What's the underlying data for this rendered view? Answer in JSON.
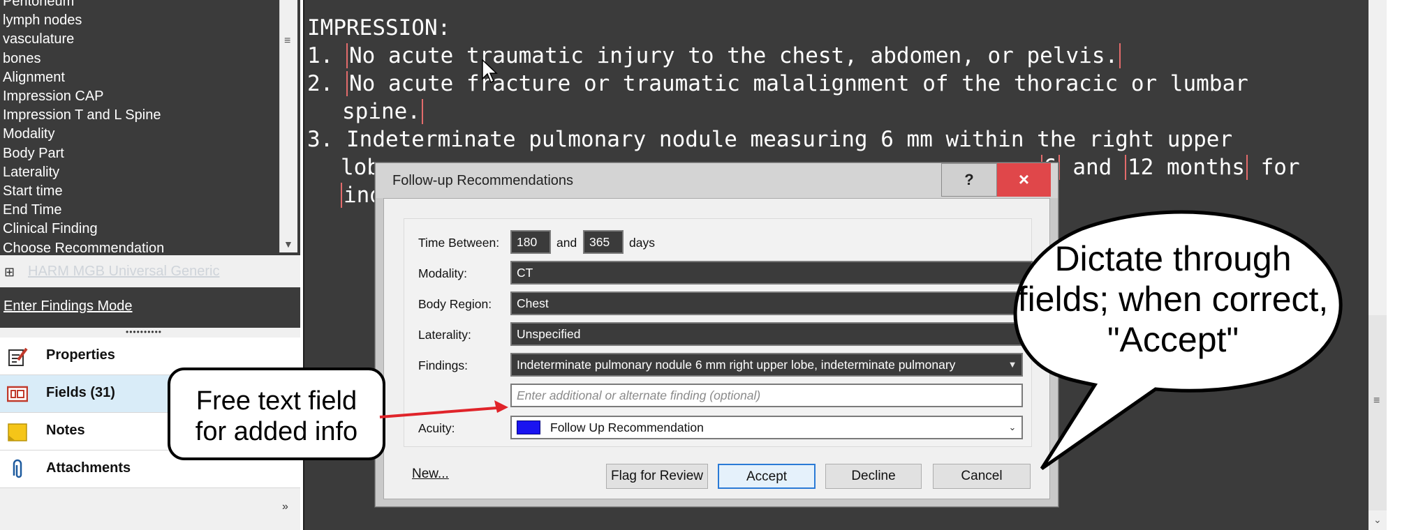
{
  "field_list": {
    "items": [
      "Peritoneum",
      "lymph nodes",
      "vasculature",
      "bones",
      "Alignment",
      "Impression CAP",
      "Impression T and L Spine",
      "Modality",
      "Body Part",
      "Laterality",
      "Start time",
      "End Time",
      "Clinical Finding",
      "Choose Recommendation"
    ]
  },
  "template": {
    "name": "HARM MGB Universal Generic"
  },
  "findings_mode": {
    "label": "Enter Findings Mode"
  },
  "nav": {
    "properties": "Properties",
    "fields": "Fields (31)",
    "notes": "Notes",
    "attachments": "Attachments",
    "more": "»"
  },
  "report": {
    "heading": "IMPRESSION:",
    "l1_num": "1. ",
    "l1_field": "No acute traumatic injury to the chest, abdomen, or pelvis.",
    "l2_num": "2. ",
    "l2_field_a": "No acute fracture or traumatic malalignment of the thoracic or lumbar",
    "l2_field_b": "spine.",
    "l3_a": "3. Indeterminate pulmonary nodule measuring 6 mm within the right upper",
    "l3_b_start": "lob",
    "l3_b_num1": "6",
    "l3_b_and": " and ",
    "l3_b_num2": "12 months",
    "l3_b_for": " for",
    "l3_c": "ind"
  },
  "dialog": {
    "title": "Follow-up Recommendations",
    "help": "?",
    "close": "×",
    "time_between_label": "Time Between:",
    "time_from": "180",
    "and_label": "and",
    "time_to": "365",
    "days_label": "days",
    "modality_label": "Modality:",
    "modality_value": "CT",
    "body_region_label": "Body Region:",
    "body_region_value": "Chest",
    "laterality_label": "Laterality:",
    "laterality_value": "Unspecified",
    "findings_label": "Findings:",
    "findings_value": "Indeterminate pulmonary nodule 6 mm right upper lobe, indeterminate pulmonary",
    "additional_placeholder": "Enter additional or alternate finding (optional)",
    "acuity_label": "Acuity:",
    "acuity_value": "Follow Up Recommendation",
    "acuity_color": "#1a14f0",
    "new_link": "New...",
    "flag_button": "Flag for Review",
    "accept_button": "Accept",
    "decline_button": "Decline",
    "cancel_button": "Cancel"
  },
  "callouts": {
    "left": [
      "Free text field",
      "for added info"
    ],
    "right": [
      "Dictate through",
      "fields; when correct,",
      "\"Accept\""
    ]
  },
  "colors": {
    "editor_bg": "#3b3b3b",
    "field_bracket": "#e36b6b",
    "arrow": "#e0242a",
    "close_button": "#e0474a"
  }
}
